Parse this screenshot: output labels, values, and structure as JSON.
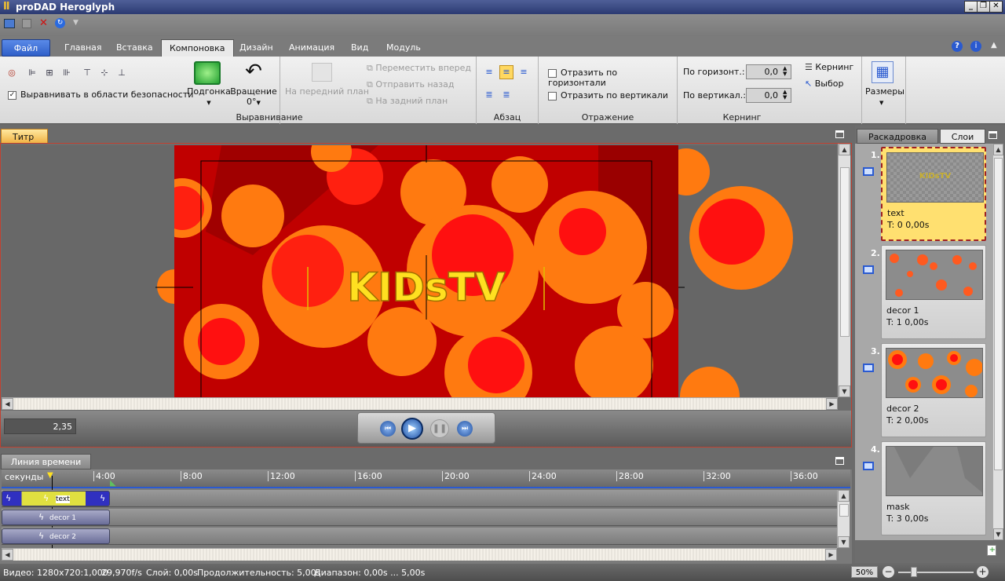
{
  "app": {
    "title": "proDAD Heroglyph"
  },
  "window_controls": {
    "minimize": "_",
    "restore": "❐",
    "close": "✕"
  },
  "tabs": [
    {
      "label": "Файл"
    },
    {
      "label": "Главная"
    },
    {
      "label": "Вставка"
    },
    {
      "label": "Компоновка"
    },
    {
      "label": "Дизайн"
    },
    {
      "label": "Анимация"
    },
    {
      "label": "Вид"
    },
    {
      "label": "Модуль"
    }
  ],
  "ribbon": {
    "align_safe_label": "Выравнивать в области безопасности",
    "fit_label": "Подгонка",
    "rotation_label": "Вращение",
    "rotation_value": "0°",
    "bring_front_label": "На передний план",
    "move_forward_label": "Переместить вперед",
    "send_back_label": "Отправить назад",
    "to_back_label": "На задний план",
    "group_align_label": "Выравнивание",
    "group_paragraph_label": "Абзац",
    "flip_h_label": "Отразить по горизонтали",
    "flip_v_label": "Отразить по вертикали",
    "group_reflection_label": "Отражение",
    "kern_h_label": "По горизонт.:",
    "kern_h_value": "0,0",
    "kern_v_label": "По вертикал.:",
    "kern_v_value": "0,0",
    "group_kerning_label": "Кернинг",
    "kerning_btn_label": "Кернинг",
    "select_btn_label": "Выбор",
    "sizes_label": "Размеры"
  },
  "preview": {
    "tab_label": "Титр",
    "title_text": "KIDsTV",
    "time_value": "2,35"
  },
  "timeline": {
    "tab_label": "Линия времени",
    "units_label": "секунды",
    "ticks": [
      "4:00",
      "8:00",
      "12:00",
      "16:00",
      "20:00",
      "24:00",
      "28:00",
      "32:00",
      "36:00"
    ],
    "tracks": [
      {
        "name": "text"
      },
      {
        "name": "decor 1"
      },
      {
        "name": "decor 2"
      }
    ]
  },
  "side": {
    "tab_storyboard": "Раскадровка",
    "tab_layers": "Слои",
    "layers": [
      {
        "num": "1.",
        "name": "text",
        "time": "T: 0  0,00s",
        "thumb_text": "KIDsTV"
      },
      {
        "num": "2.",
        "name": "decor 1",
        "time": "T: 1  0,00s"
      },
      {
        "num": "3.",
        "name": "decor 2",
        "time": "T: 2  0,00s"
      },
      {
        "num": "4.",
        "name": "mask",
        "time": "T: 3  0,00s"
      }
    ]
  },
  "status": {
    "video": "Видео: 1280x720:1,000",
    "fps": "29,970f/s",
    "layer": "Слой: 0,00s",
    "duration": "Продолжительность: 5,00s",
    "range": "Диапазон: 0,00s ... 5,00s",
    "zoom": "50%"
  },
  "colors": {
    "accent": "#2f5fc8",
    "canvas_bg": "#c00000",
    "circle_orange": "#ff7a10",
    "circle_red": "#ff1010"
  }
}
